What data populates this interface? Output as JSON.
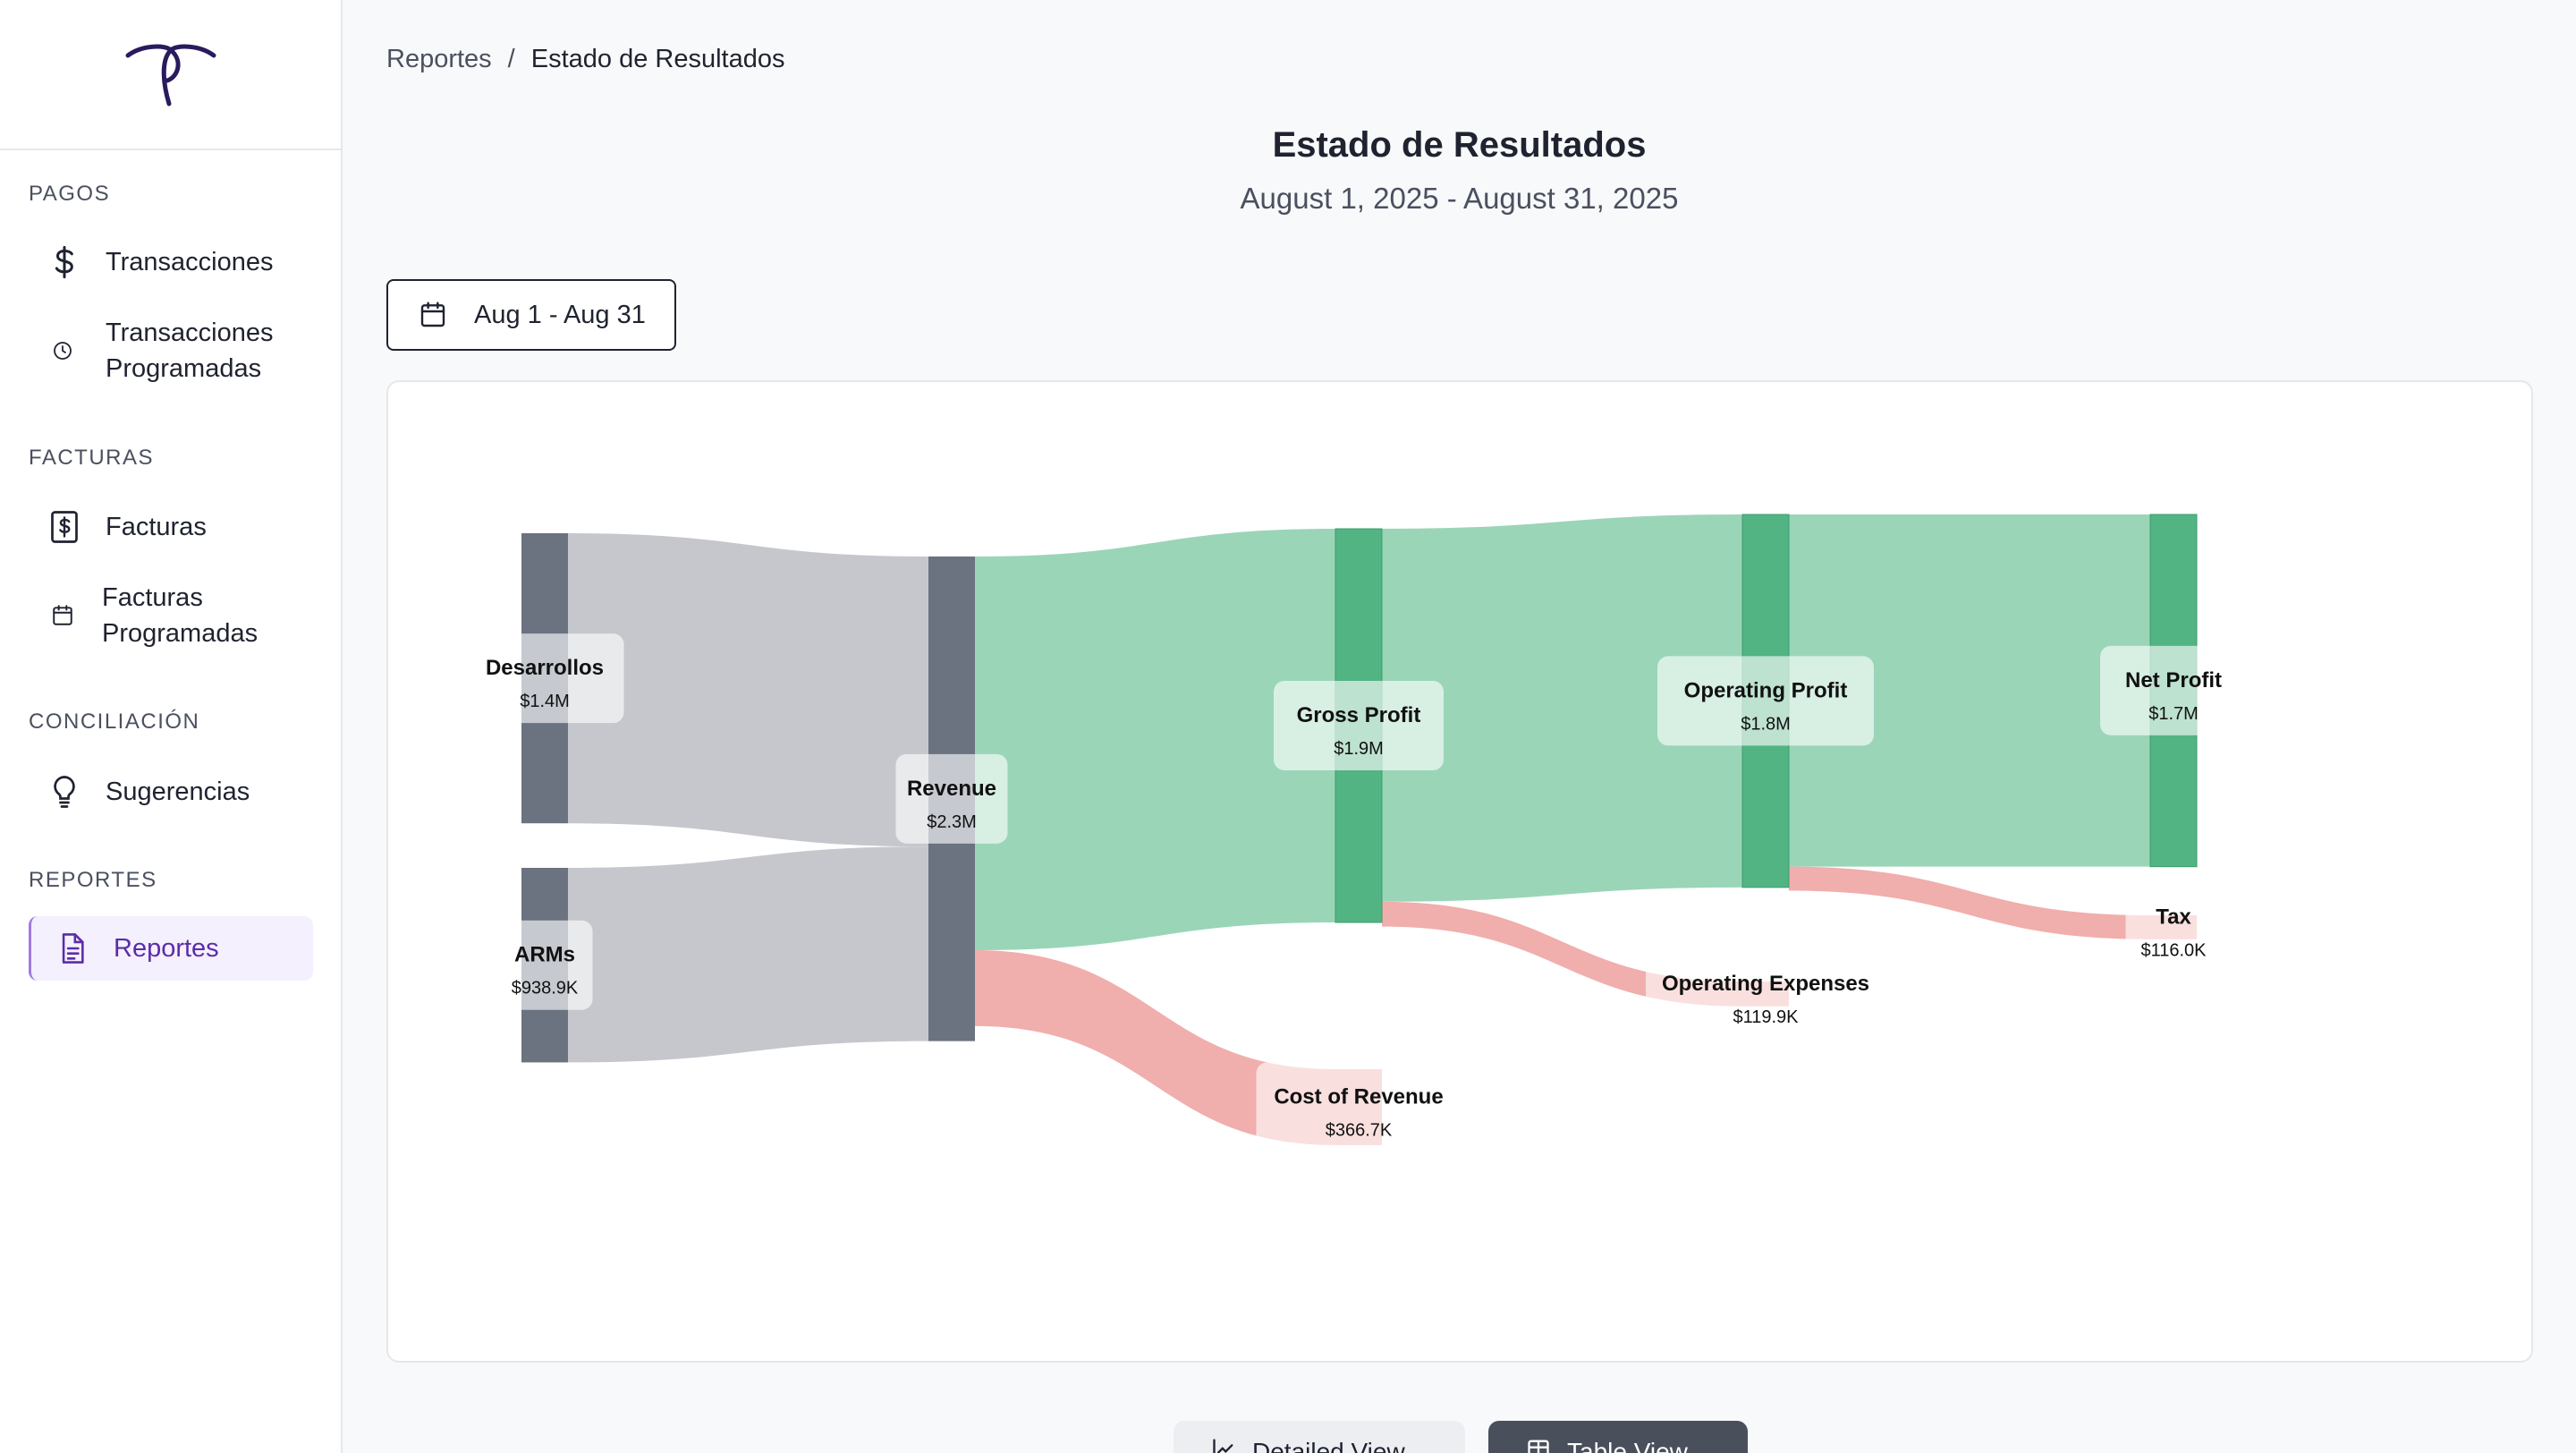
{
  "sidebar": {
    "sections": [
      {
        "label": "PAGOS",
        "items": [
          {
            "label": "Transacciones",
            "icon": "dollar-icon"
          },
          {
            "label": "Transacciones Programadas",
            "icon": "clock-icon"
          }
        ]
      },
      {
        "label": "FACTURAS",
        "items": [
          {
            "label": "Facturas",
            "icon": "invoice-icon"
          },
          {
            "label": "Facturas Programadas",
            "icon": "calendar-icon"
          }
        ]
      },
      {
        "label": "CONCILIACIÓN",
        "items": [
          {
            "label": "Sugerencias",
            "icon": "lightbulb-icon"
          }
        ]
      },
      {
        "label": "REPORTES",
        "items": [
          {
            "label": "Reportes",
            "icon": "document-icon",
            "active": true
          }
        ]
      }
    ]
  },
  "breadcrumb": {
    "parent": "Reportes",
    "separator": "/",
    "current": "Estado de Resultados"
  },
  "header": {
    "title": "Estado de Resultados",
    "subtitle": "August 1, 2025 - August 31, 2025"
  },
  "date_filter": {
    "label": "Aug 1 - Aug 31"
  },
  "bottom_buttons": {
    "detail_label": "Detailed View",
    "table_label": "Table View"
  },
  "colors": {
    "accent": "#7c3aed",
    "node_gray": "#6b7280",
    "link_gray": "#c5c7cd",
    "node_green": "#52b483",
    "link_green": "#9ad5b8",
    "loss_red": "#f0aeac"
  },
  "chart_data": {
    "type": "sankey",
    "nodes": [
      {
        "id": "desarrollos",
        "name": "Desarrollos",
        "value_label": "$1.4M",
        "value": 1400000
      },
      {
        "id": "arms",
        "name": "ARMs",
        "value_label": "$938.9K",
        "value": 938900
      },
      {
        "id": "revenue",
        "name": "Revenue",
        "value_label": "$2.3M",
        "value": 2300000
      },
      {
        "id": "cost_of_revenue",
        "name": "Cost of Revenue",
        "value_label": "$366.7K",
        "value": 366700
      },
      {
        "id": "gross_profit",
        "name": "Gross Profit",
        "value_label": "$1.9M",
        "value": 1900000
      },
      {
        "id": "operating_expenses",
        "name": "Operating Expenses",
        "value_label": "$119.9K",
        "value": 119900
      },
      {
        "id": "operating_profit",
        "name": "Operating Profit",
        "value_label": "$1.8M",
        "value": 1800000
      },
      {
        "id": "tax",
        "name": "Tax",
        "value_label": "$116.0K",
        "value": 116000
      },
      {
        "id": "net_profit",
        "name": "Net Profit",
        "value_label": "$1.7M",
        "value": 1700000
      }
    ],
    "links": [
      {
        "source": "desarrollos",
        "target": "revenue",
        "value": 1400000
      },
      {
        "source": "arms",
        "target": "revenue",
        "value": 938900
      },
      {
        "source": "revenue",
        "target": "gross_profit",
        "value": 1900000
      },
      {
        "source": "revenue",
        "target": "cost_of_revenue",
        "value": 366700
      },
      {
        "source": "gross_profit",
        "target": "operating_profit",
        "value": 1800000
      },
      {
        "source": "gross_profit",
        "target": "operating_expenses",
        "value": 119900
      },
      {
        "source": "operating_profit",
        "target": "net_profit",
        "value": 1700000
      },
      {
        "source": "operating_profit",
        "target": "tax",
        "value": 116000
      }
    ]
  }
}
